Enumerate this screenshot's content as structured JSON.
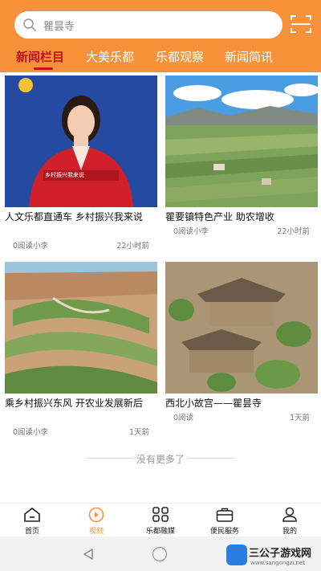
{
  "search": {
    "placeholder": "瞿昙寺"
  },
  "tabs": [
    {
      "label": "新闻栏目",
      "active": true
    },
    {
      "label": "大美乐都",
      "active": false
    },
    {
      "label": "乐都观察",
      "active": false
    },
    {
      "label": "新闻简讯",
      "active": false
    }
  ],
  "articles": [
    {
      "title": "人文乐都直通车 乡村振兴我来说",
      "reads": "0阅读小李",
      "time": "22小时前",
      "thumb_caption": "乡村振兴我来说"
    },
    {
      "title": "瞿要镇特色产业 助农增收",
      "reads": "0阅读小李",
      "time": "22小时前"
    },
    {
      "title": "乘乡村振兴东风 开农业发展新后",
      "reads": "0阅读小李",
      "time": "1天前"
    },
    {
      "title": "西北小故宫——瞿昙寺",
      "reads": "0阅读",
      "time": "1天前"
    }
  ],
  "no_more": "没有更多了",
  "bottom_nav": [
    {
      "label": "首页",
      "icon": "home-icon",
      "active": false
    },
    {
      "label": "视频",
      "icon": "video-icon",
      "active": true
    },
    {
      "label": "乐都融媒",
      "icon": "grid-icon",
      "active": false
    },
    {
      "label": "便民服务",
      "icon": "briefcase-icon",
      "active": false
    },
    {
      "label": "我的",
      "icon": "user-icon",
      "active": false
    }
  ],
  "watermark": {
    "text": "三公子游戏网",
    "url": "www.sangongzi.net"
  },
  "colors": {
    "accent": "#f7913a",
    "active_tab": "#c0141b"
  }
}
